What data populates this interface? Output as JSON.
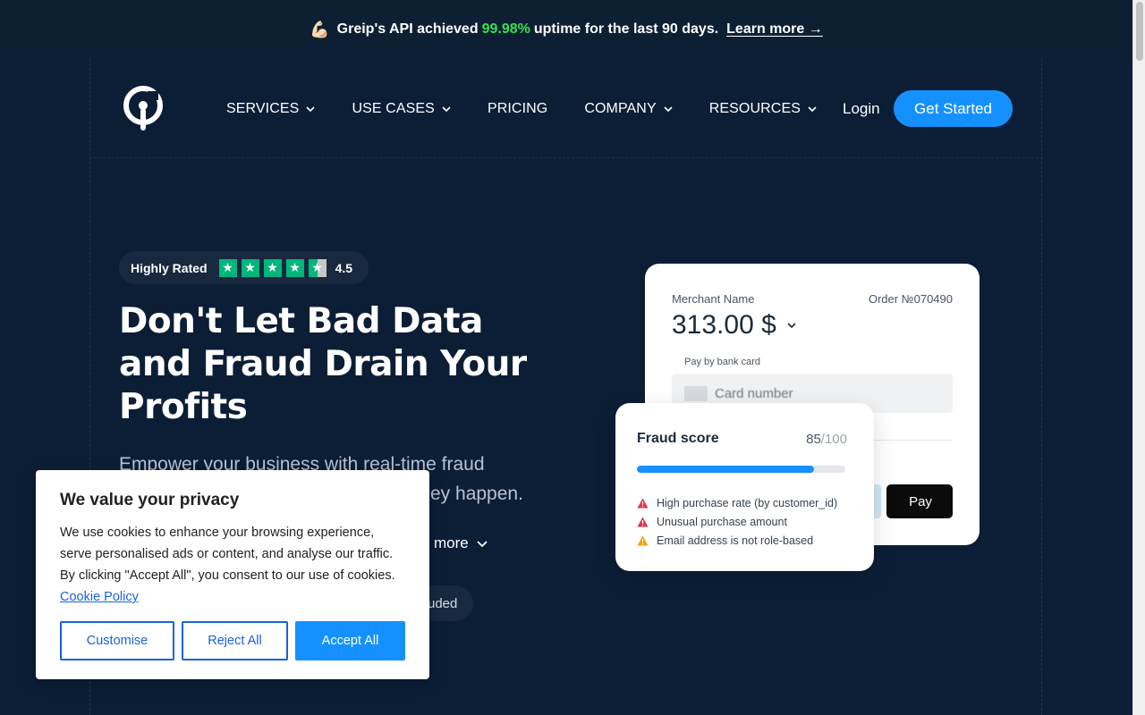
{
  "announcement": {
    "emoji": "💪🏻",
    "text_before": "Greip's API achieved",
    "uptime": "99.98%",
    "text_after": "uptime for the last 90 days.",
    "link": "Learn more →"
  },
  "nav": {
    "items": [
      {
        "label": "SERVICES",
        "dropdown": true
      },
      {
        "label": "USE CASES",
        "dropdown": true
      },
      {
        "label": "PRICING",
        "dropdown": false
      },
      {
        "label": "COMPANY",
        "dropdown": true
      },
      {
        "label": "RESOURCES",
        "dropdown": true
      }
    ],
    "login": "Login",
    "cta": "Get Started"
  },
  "hero": {
    "rating_label": "Highly Rated",
    "rating_value": "4.5",
    "rating_stars": 4.5,
    "headline": "Don't Let Bad Data and Fraud Drain Your Profits",
    "subtext": "Empower your business with real-time fraud ey happen.",
    "subtext_line1": "Empower your business with real-time fraud",
    "subtext_line2": "ey happen.",
    "learn_more": "more",
    "pill_text": "uded"
  },
  "payment_card": {
    "merchant_label": "Merchant Name",
    "order": "Order №070490",
    "amount": "313.00 $",
    "pay_label": "Pay by bank card",
    "card_placeholder": "Card number",
    "apple_pay": "Pay"
  },
  "fraud_card": {
    "title": "Fraud score",
    "score": "85",
    "max": "/100",
    "score_fraction": 0.85,
    "reasons": [
      {
        "text": "High purchase rate (by customer_id)",
        "level": "high"
      },
      {
        "text": "Unusual purchase amount",
        "level": "high"
      },
      {
        "text": "Email address is not role-based",
        "level": "medium"
      }
    ]
  },
  "cookie_banner": {
    "title": "We value your privacy",
    "body": "We use cookies to enhance your browsing experience, serve personalised ads or content, and analyse our traffic. By clicking \"Accept All\", you consent to our use of cookies.",
    "policy_link": "Cookie Policy",
    "customise": "Customise",
    "reject": "Reject All",
    "accept": "Accept All"
  },
  "colors": {
    "background": "#0c1e36",
    "accent": "#1491ff",
    "uptime_green": "#3ddc56",
    "trustpilot_green": "#00b67a",
    "warning_red": "#e0324b",
    "warning_orange": "#f59e0b"
  }
}
